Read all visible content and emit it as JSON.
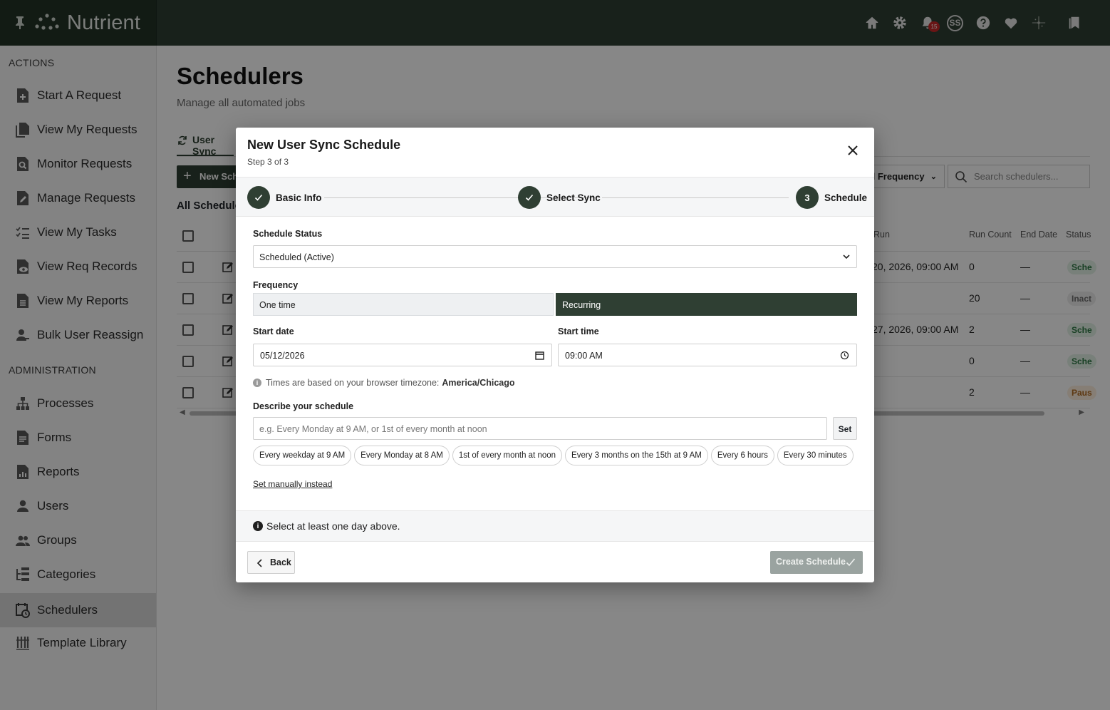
{
  "app": {
    "brand": "Nutrient",
    "notification_count": "15",
    "avatar_initials": "SS"
  },
  "sidebar": {
    "actions_title": "ACTIONS",
    "actions": [
      {
        "label": "Start A Request",
        "icon": "request-add-icon"
      },
      {
        "label": "View My Requests",
        "icon": "documents-icon"
      },
      {
        "label": "Monitor Requests",
        "icon": "document-search-icon"
      },
      {
        "label": "Manage Requests",
        "icon": "document-edit-icon"
      },
      {
        "label": "View My Tasks",
        "icon": "checklist-icon"
      },
      {
        "label": "View Req Records",
        "icon": "document-view-icon"
      },
      {
        "label": "View My Reports",
        "icon": "report-icon"
      },
      {
        "label": "Bulk User Reassign",
        "icon": "user-reassign-icon"
      }
    ],
    "admin_title": "ADMINISTRATION",
    "admin": [
      {
        "label": "Processes",
        "icon": "hierarchy-icon"
      },
      {
        "label": "Forms",
        "icon": "form-icon"
      },
      {
        "label": "Reports",
        "icon": "report-icon"
      },
      {
        "label": "Users",
        "icon": "user-icon"
      },
      {
        "label": "Groups",
        "icon": "group-icon"
      },
      {
        "label": "Categories",
        "icon": "categories-icon"
      },
      {
        "label": "Schedulers",
        "icon": "calendar-clock-icon",
        "active": true
      },
      {
        "label": "Template Library",
        "icon": "library-icon"
      }
    ]
  },
  "page": {
    "title": "Schedulers",
    "subtitle": "Manage all automated jobs",
    "tab": "User Sync",
    "new_button": "New Sche",
    "frequency_filter": "ll Frequency",
    "search_placeholder": "Search schedulers...",
    "list_title": "All Scheduler",
    "columns": {
      "run": "Run",
      "run_count": "Run Count",
      "end_date": "End Date",
      "status": "Status"
    },
    "rows": [
      {
        "run": "20, 2026, 09:00 AM",
        "run_count": "0",
        "end_date": "—",
        "status": "Sche"
      },
      {
        "run": "",
        "run_count": "20",
        "end_date": "—",
        "status": "Inact"
      },
      {
        "run": "27, 2026, 09:00 AM",
        "run_count": "2",
        "end_date": "—",
        "status": "Sche"
      },
      {
        "run": "",
        "run_count": "0",
        "end_date": "—",
        "status": "Sche"
      },
      {
        "run": "",
        "run_count": "2",
        "end_date": "—",
        "status": "Paus"
      }
    ]
  },
  "modal": {
    "title": "New User Sync Schedule",
    "step_text": "Step 3 of 3",
    "steps": [
      {
        "label": "Basic Info",
        "state": "done"
      },
      {
        "label": "Select Sync",
        "state": "done"
      },
      {
        "label": "Schedule",
        "state": "current",
        "number": "3"
      }
    ],
    "schedule_status_label": "Schedule Status",
    "schedule_status_value": "Scheduled (Active)",
    "frequency_label": "Frequency",
    "frequency_options": [
      "One time",
      "Recurring"
    ],
    "frequency_selected": "Recurring",
    "start_date_label": "Start date",
    "start_date_value": "05/12/2026",
    "start_time_label": "Start time",
    "start_time_value": "09:00 AM",
    "timezone_note": "Times are based on your browser timezone:",
    "timezone_value": "America/Chicago",
    "describe_label": "Describe your schedule",
    "describe_placeholder": "e.g. Every Monday at 9 AM, or 1st of every month at noon",
    "set_button": "Set",
    "suggestions": [
      "Every weekday at 9 AM",
      "Every Monday at 8 AM",
      "1st of every month at noon",
      "Every 3 months on the 15th at 9 AM",
      "Every 6 hours",
      "Every 30 minutes"
    ],
    "manual_link": "Set manually instead",
    "notice": "Select at least one day above.",
    "back_button": "Back",
    "create_button": "Create Schedule"
  },
  "colors": {
    "brand_dark": "#2f3f33",
    "overlay": "rgba(0,0,0,0.47)",
    "notification_badge": "#c62828",
    "disabled_button": "#9aa3a0"
  }
}
